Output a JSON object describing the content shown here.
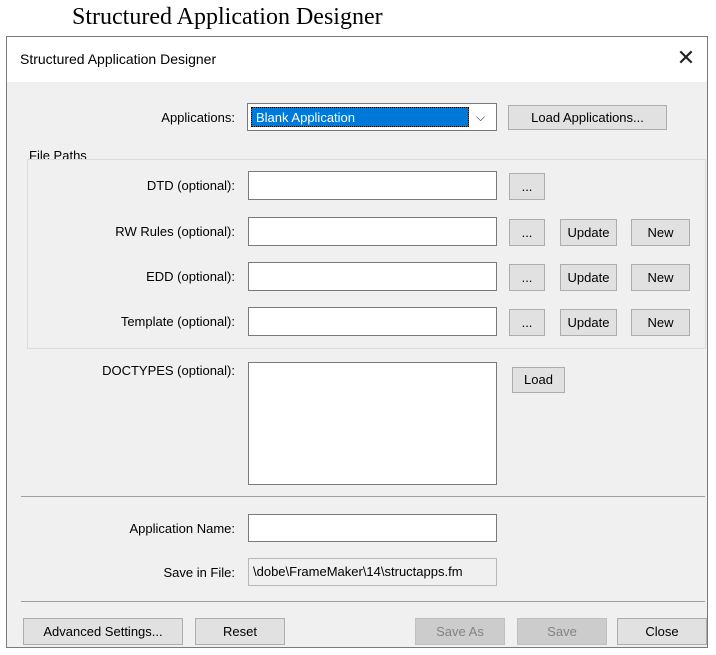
{
  "window_caption": "Structured Application Designer",
  "dialog": {
    "title": "Structured Application Designer",
    "close_glyph": "✕"
  },
  "applications": {
    "label": "Applications:",
    "selected": "Blank Application",
    "dropdown_glyph": "⌵",
    "load_button": "Load Applications..."
  },
  "file_paths": {
    "group_label": "File Paths",
    "rows": [
      {
        "label": "DTD (optional):",
        "value": "",
        "browse": "...",
        "update": null,
        "new": null
      },
      {
        "label": "RW Rules (optional):",
        "value": "",
        "browse": "...",
        "update": "Update",
        "new": "New"
      },
      {
        "label": "EDD (optional):",
        "value": "",
        "browse": "...",
        "update": "Update",
        "new": "New"
      },
      {
        "label": "Template (optional):",
        "value": "",
        "browse": "...",
        "update": "Update",
        "new": "New"
      }
    ]
  },
  "doctypes": {
    "label": "DOCTYPES (optional):",
    "load_button": "Load"
  },
  "application_name": {
    "label": "Application Name:",
    "value": ""
  },
  "save_in_file": {
    "label": "Save in File:",
    "value": "\\dobe\\FrameMaker\\14\\structapps.fm"
  },
  "footer": {
    "advanced": "Advanced Settings...",
    "reset": "Reset",
    "save_as": "Save As",
    "save": "Save",
    "close": "Close"
  }
}
